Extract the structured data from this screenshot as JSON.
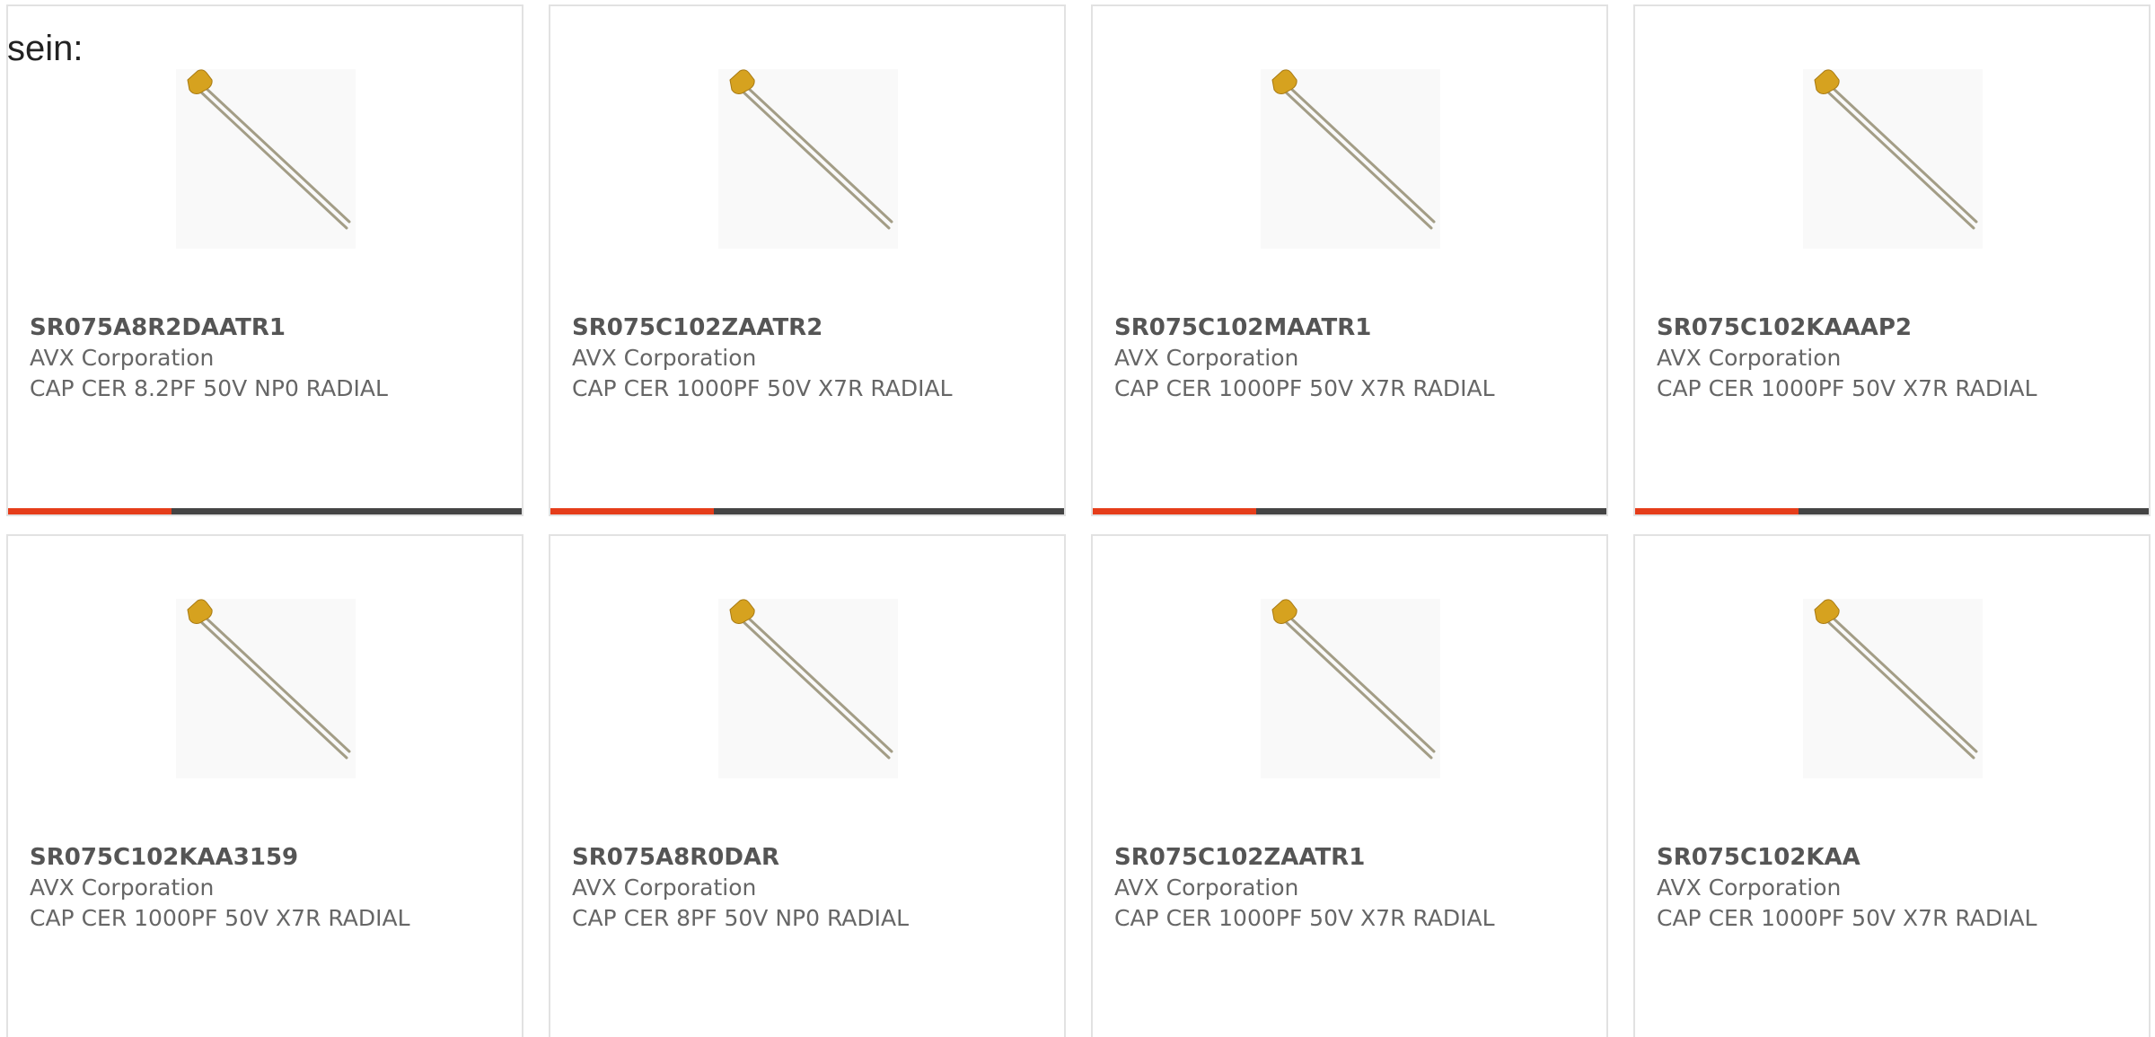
{
  "lead_text": "sein:",
  "colors": {
    "bar_accent": "#e53d1a",
    "bar_dark": "#444444",
    "capacitor_body": "#d6a21f",
    "capacitor_leads": "#a39d86"
  },
  "products": [
    {
      "part_number": "SR075A8R2DAATR1",
      "manufacturer": "AVX Corporation",
      "description": "CAP CER 8.2PF 50V NP0 RADIAL",
      "image_icon": "radial-capacitor-icon"
    },
    {
      "part_number": "SR075C102ZAATR2",
      "manufacturer": "AVX Corporation",
      "description": "CAP CER 1000PF 50V X7R RADIAL",
      "image_icon": "radial-capacitor-icon"
    },
    {
      "part_number": "SR075C102MAATR1",
      "manufacturer": "AVX Corporation",
      "description": "CAP CER 1000PF 50V X7R RADIAL",
      "image_icon": "radial-capacitor-icon"
    },
    {
      "part_number": "SR075C102KAAAP2",
      "manufacturer": "AVX Corporation",
      "description": "CAP CER 1000PF 50V X7R RADIAL",
      "image_icon": "radial-capacitor-icon"
    },
    {
      "part_number": "SR075C102KAA3159",
      "manufacturer": "AVX Corporation",
      "description": "CAP CER 1000PF 50V X7R RADIAL",
      "image_icon": "radial-capacitor-icon"
    },
    {
      "part_number": "SR075A8R0DAR",
      "manufacturer": "AVX Corporation",
      "description": "CAP CER 8PF 50V NP0 RADIAL",
      "image_icon": "radial-capacitor-icon"
    },
    {
      "part_number": "SR075C102ZAATR1",
      "manufacturer": "AVX Corporation",
      "description": "CAP CER 1000PF 50V X7R RADIAL",
      "image_icon": "radial-capacitor-icon"
    },
    {
      "part_number": "SR075C102KAA",
      "manufacturer": "AVX Corporation",
      "description": "CAP CER 1000PF 50V X7R RADIAL",
      "image_icon": "radial-capacitor-icon"
    }
  ]
}
